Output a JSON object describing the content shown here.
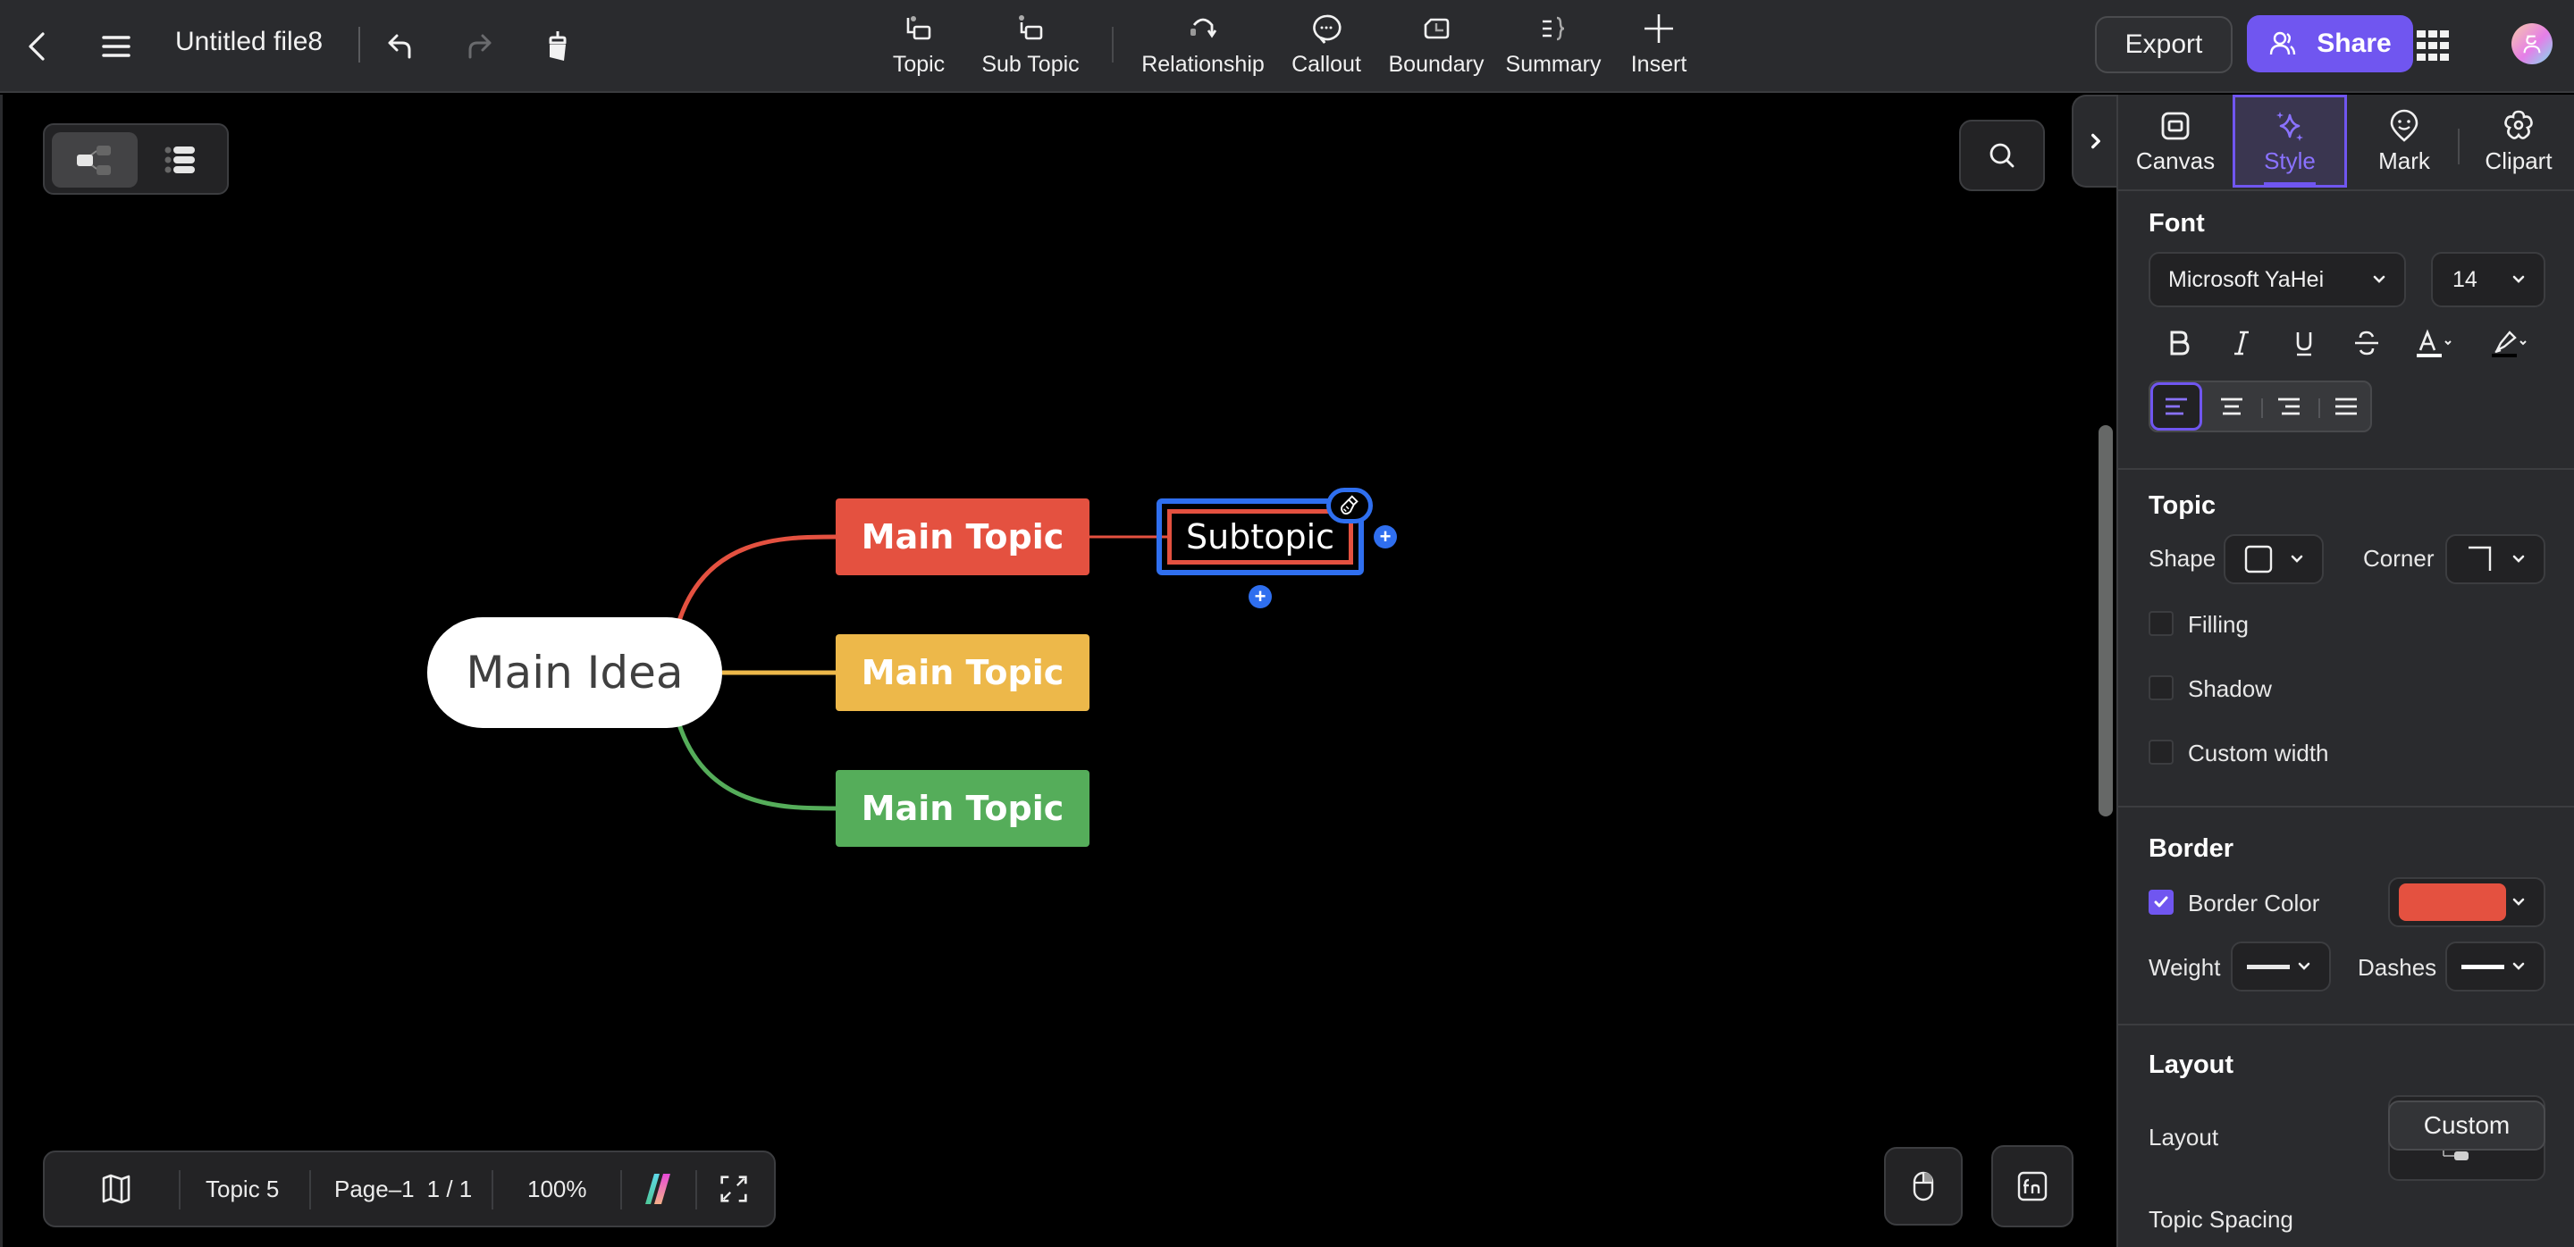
{
  "header": {
    "file_title": "Untitled file8",
    "icons": {
      "back": "chevron-left-icon",
      "menu": "hamburger-menu-icon",
      "undo": "undo-icon",
      "redo": "redo-icon",
      "format_painter": "format-painter-icon"
    },
    "tools": [
      {
        "label": "Topic",
        "icon": "topic-icon"
      },
      {
        "label": "Sub Topic",
        "icon": "subtopic-icon"
      },
      {
        "label": "Relationship",
        "icon": "relationship-icon"
      },
      {
        "label": "Callout",
        "icon": "callout-icon"
      },
      {
        "label": "Boundary",
        "icon": "boundary-icon"
      },
      {
        "label": "Summary",
        "icon": "summary-icon"
      },
      {
        "label": "Insert",
        "icon": "plus-icon"
      }
    ],
    "export_label": "Export",
    "share_label": "Share"
  },
  "canvas": {
    "view_modes": [
      "mind-map-view",
      "outline-view"
    ],
    "active_view": "mind-map-view",
    "mindmap": {
      "root": {
        "label": "Main Idea",
        "fill": "#ffffff",
        "text_color": "#404040"
      },
      "main_topics": [
        {
          "label": "Main Topic",
          "fill": "#e45140",
          "line_color": "#e45140"
        },
        {
          "label": "Main Topic",
          "fill": "#edb84a",
          "line_color": "#edb84a"
        },
        {
          "label": "Main Topic",
          "fill": "#55ad5a",
          "line_color": "#55ad5a"
        }
      ],
      "subtopic": {
        "label": "Subtopic",
        "border_color": "#e45140",
        "selected": true,
        "parent_index": 0
      },
      "selection_color": "#2f6fef",
      "add_glyph": "+"
    }
  },
  "statusbar": {
    "topic_count": "Topic 5",
    "page_label": "Page–1",
    "page_position": "1 / 1",
    "zoom": "100%"
  },
  "right_panel": {
    "tabs": [
      {
        "label": "Canvas",
        "icon": "canvas-icon",
        "active": false
      },
      {
        "label": "Style",
        "icon": "sparkle-icon",
        "active": true
      },
      {
        "label": "Mark",
        "icon": "mark-icon",
        "active": false
      },
      {
        "label": "Clipart",
        "icon": "clipart-icon",
        "active": false
      }
    ],
    "font": {
      "title": "Font",
      "family": "Microsoft YaHei",
      "size": "14",
      "alignment_active": "left"
    },
    "topic": {
      "title": "Topic",
      "shape_label": "Shape",
      "corner_label": "Corner",
      "filling_label": "Filling",
      "filling_checked": false,
      "shadow_label": "Shadow",
      "shadow_checked": false,
      "custom_width_label": "Custom width",
      "custom_width_checked": false
    },
    "border": {
      "title": "Border",
      "color_label": "Border Color",
      "color_checked": true,
      "color": "#e45140",
      "weight_label": "Weight",
      "dashes_label": "Dashes"
    },
    "layout": {
      "title": "Layout",
      "layout_label": "Layout",
      "spacing_label": "Topic Spacing",
      "spacing_value": "Custom",
      "preview_accent": "#ee7036"
    }
  },
  "colors": {
    "accent": "#7056f0",
    "header_bg": "#2a2b2e",
    "canvas_bg": "#000000"
  }
}
